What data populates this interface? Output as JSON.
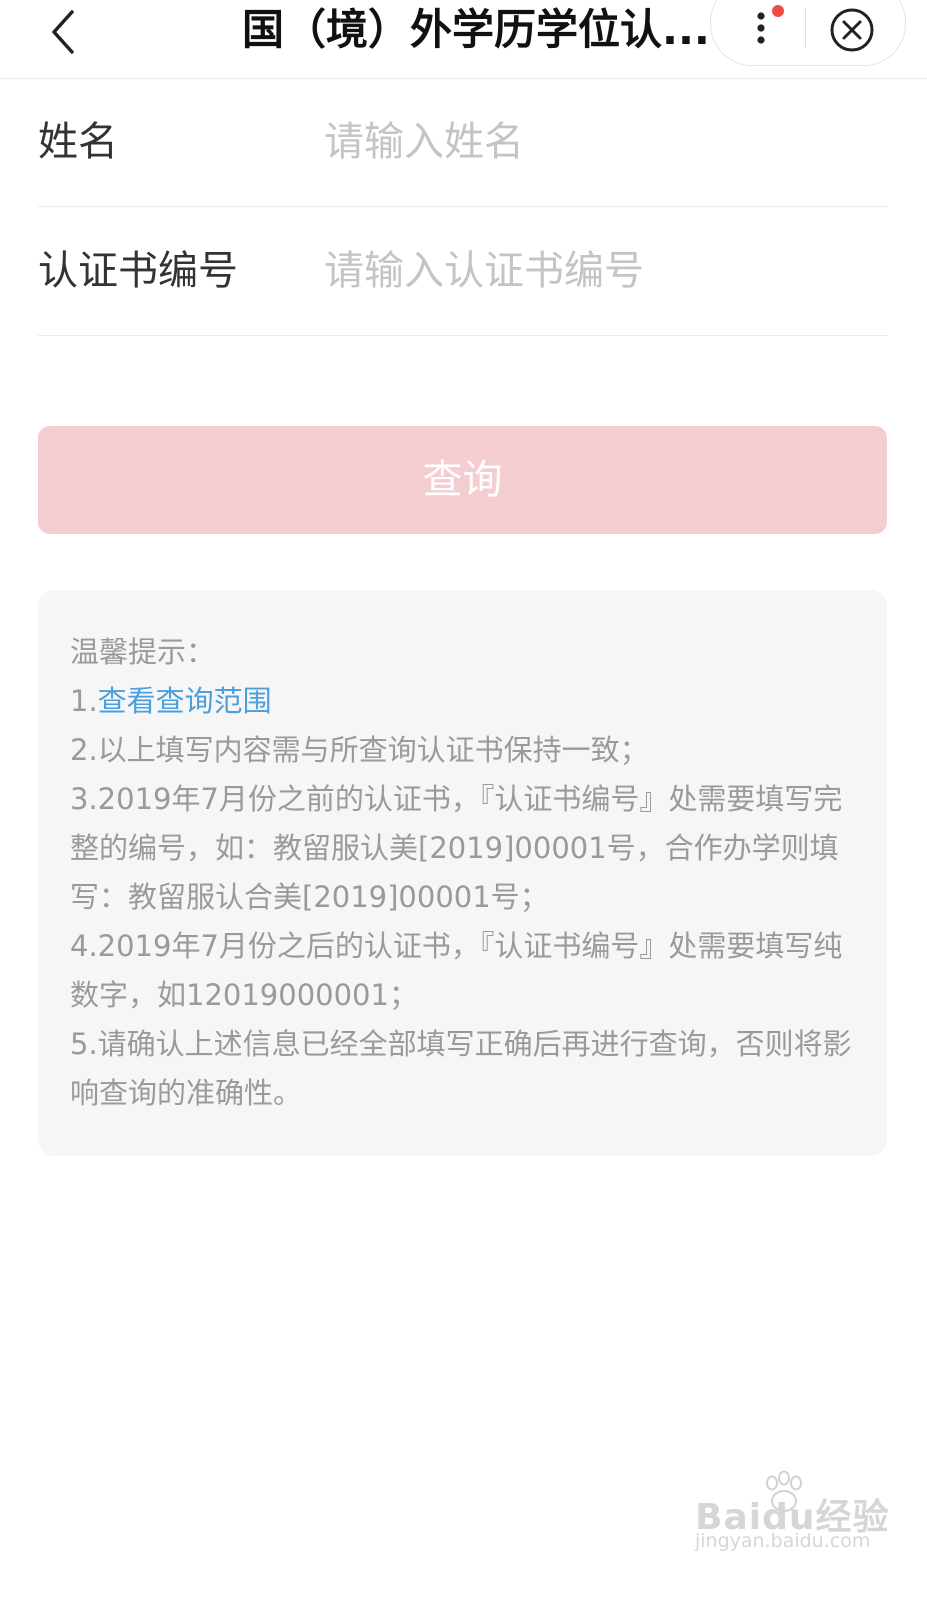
{
  "header": {
    "title": "国（境）外学历学位认...",
    "back_icon": "chevron-left-icon",
    "more_icon": "more-vertical-icon",
    "close_icon": "close-circle-icon",
    "badge_color": "#f04a45"
  },
  "form": {
    "name_label": "姓名",
    "name_placeholder": "请输入姓名",
    "name_value": "",
    "cert_label": "认证书编号",
    "cert_placeholder": "请输入认证书编号",
    "cert_value": ""
  },
  "query_button": {
    "label": "查询",
    "color": "#f3cdd0"
  },
  "tips": {
    "title": "温馨提示：",
    "items": [
      {
        "prefix": "1.",
        "link": "查看查询范围"
      },
      {
        "text": "2.以上填写内容需与所查询认证书保持一致；"
      },
      {
        "text": "3.2019年7月份之前的认证书，『认证书编号』处需要填写完整的编号，如：教留服认美[2019]00001号，合作办学则填写：教留服认合美[2019]00001号；"
      },
      {
        "text": "4.2019年7月份之后的认证书，『认证书编号』处需要填写纯数字，如12019000001；"
      },
      {
        "text": "5.请确认上述信息已经全部填写正确后再进行查询，否则将影响查询的准确性。"
      }
    ],
    "link_color": "#4a9fdc"
  },
  "watermark": {
    "brand": "Baidu经验",
    "url": "jingyan.baidu.com"
  }
}
